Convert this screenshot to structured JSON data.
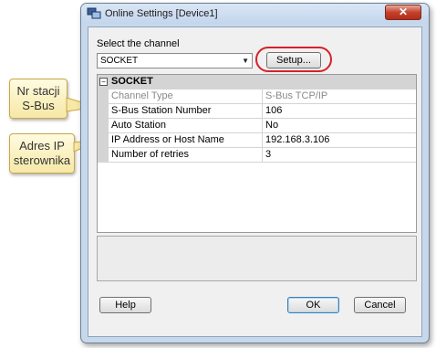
{
  "window": {
    "title": "Online Settings [Device1]",
    "close_glyph": "✕"
  },
  "channel": {
    "label": "Select the channel",
    "selected": "SOCKET",
    "setup_label": "Setup..."
  },
  "grid": {
    "category": "SOCKET",
    "category_toggle": "⊟",
    "rows": [
      {
        "name": "Channel Type",
        "value": "S-Bus TCP/IP"
      },
      {
        "name": "S-Bus Station Number",
        "value": "106"
      },
      {
        "name": "Auto Station",
        "value": "No"
      },
      {
        "name": "IP Address or Host Name",
        "value": "192.168.3.106"
      },
      {
        "name": "Number of retries",
        "value": "3"
      }
    ]
  },
  "buttons": {
    "help": "Help",
    "ok": "OK",
    "cancel": "Cancel"
  },
  "callouts": {
    "station_line1": "Nr stacji",
    "station_line2": "S-Bus",
    "ip_line1": "Adres IP",
    "ip_line2": "sterownika"
  },
  "colors": {
    "highlight": "#d5212b",
    "callout_fill": "#f6e8a6",
    "close_button": "#c5412b"
  }
}
